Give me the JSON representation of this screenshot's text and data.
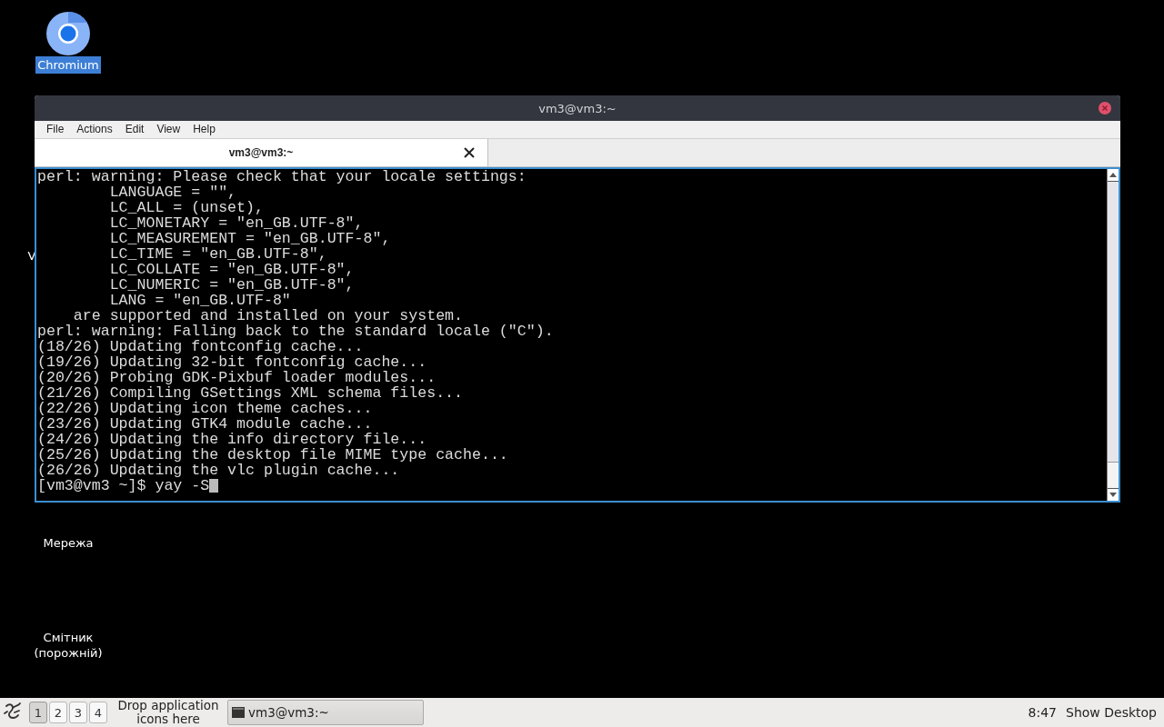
{
  "desktop_icons": [
    {
      "label": "Chromium",
      "selected": true,
      "kind": "browser"
    },
    {
      "label": "V",
      "selected": false,
      "kind": "hidden"
    },
    {
      "label": "Мережа",
      "selected": false,
      "kind": "plain"
    },
    {
      "label": "Смітник (порожній)",
      "selected": false,
      "kind": "plain"
    }
  ],
  "window": {
    "title": "vm3@vm3:~",
    "menu": [
      "File",
      "Actions",
      "Edit",
      "View",
      "Help"
    ],
    "tabs": [
      {
        "label": "vm3@vm3:~",
        "selected": true
      }
    ],
    "terminal": {
      "lines": [
        "perl: warning: Please check that your locale settings:",
        "        LANGUAGE = \"\",",
        "        LC_ALL = (unset),",
        "        LC_MONETARY = \"en_GB.UTF-8\",",
        "        LC_MEASUREMENT = \"en_GB.UTF-8\",",
        "        LC_TIME = \"en_GB.UTF-8\",",
        "        LC_COLLATE = \"en_GB.UTF-8\",",
        "        LC_NUMERIC = \"en_GB.UTF-8\",",
        "        LANG = \"en_GB.UTF-8\"",
        "    are supported and installed on your system.",
        "perl: warning: Falling back to the standard locale (\"C\").",
        "(18/26) Updating fontconfig cache...",
        "(19/26) Updating 32-bit fontconfig cache...",
        "(20/26) Probing GDK-Pixbuf loader modules...",
        "(21/26) Compiling GSettings XML schema files...",
        "(22/26) Updating icon theme caches...",
        "(23/26) Updating GTK4 module cache...",
        "(24/26) Updating the info directory file...",
        "(25/26) Updating the desktop file MIME type cache...",
        "(26/26) Updating the vlc plugin cache..."
      ],
      "prompt": "[vm3@vm3 ~]$ yay -S"
    }
  },
  "taskbar": {
    "workspaces": [
      {
        "label": "1",
        "selected": true
      },
      {
        "label": "2",
        "selected": false
      },
      {
        "label": "3",
        "selected": false
      },
      {
        "label": "4",
        "selected": false
      }
    ],
    "launcher_hint": "Drop application icons here",
    "tasks": [
      {
        "label": "vm3@vm3:~",
        "selected": false
      }
    ],
    "clock": "8:47",
    "show_desktop": "Show Desktop"
  }
}
